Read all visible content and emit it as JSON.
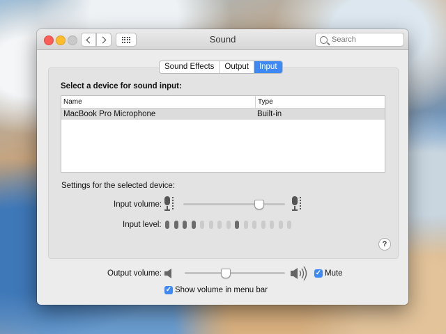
{
  "window": {
    "title": "Sound"
  },
  "search": {
    "placeholder": "Search"
  },
  "tabs": [
    {
      "label": "Sound Effects",
      "active": false
    },
    {
      "label": "Output",
      "active": false
    },
    {
      "label": "Input",
      "active": true
    }
  ],
  "input": {
    "heading": "Select a device for sound input:",
    "columns": [
      "Name",
      "Type"
    ],
    "devices": [
      {
        "name": "MacBook Pro Microphone",
        "type": "Built-in",
        "selected": true
      }
    ],
    "settings_heading": "Settings for the selected device:",
    "input_volume_label": "Input volume:",
    "input_volume_level": 0.74,
    "input_level_label": "Input level:",
    "input_level_segments": 15,
    "input_level_active": [
      0,
      1,
      2,
      3,
      8
    ]
  },
  "output": {
    "volume_label": "Output volume:",
    "volume_level": 0.4,
    "mute_label": "Mute",
    "mute_checked": true,
    "menu_bar_label": "Show volume in menu bar",
    "menu_bar_checked": true
  },
  "help_label": "?",
  "colors": {
    "accent": "#3f89f4",
    "close": "#fc5f57",
    "minimize": "#fdbc2e"
  }
}
